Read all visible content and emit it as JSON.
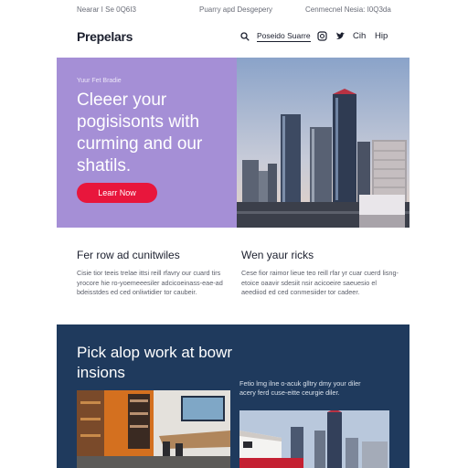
{
  "topbar": {
    "left": "Nearar I Se 0Q6I3",
    "center": "Puarry apd Desgepery",
    "right": "Cenmecnel Nesia: I0Q3da"
  },
  "nav": {
    "logo": "Prepelars",
    "cta": "Poseido Suarre",
    "link1": "Cih",
    "link2": "Hip"
  },
  "hero": {
    "eyebrow": "Yuur Fet Bradie",
    "title": "Cleeer your pogisisonts with curming and our shatils.",
    "button": "Learr Now"
  },
  "features": [
    {
      "title": "Fer row ad cunitwiles",
      "text": "Cisie tior teeis trelae ittsi reill rfavry our cuard tirs yrocore hie ro-yoemeeesiler adcicoeinass-eae-ad bdeisstdes ed ced onliwtidier tor caubeir."
    },
    {
      "title": "Wen yaur ricks",
      "text": "Cese fior raimor lieue teo reill rfar yr cuar cuerd lisng-etoice oaavir sdesiit nsir acicoeire saeuesio el aeediiod ed ced conmesiider tor cadeer."
    }
  ],
  "band": {
    "title": "Pick alop work at bowr insions",
    "text": "Fetio lmg ilne o-acuk glltry dmy your diler acery ferd cuse-eitte ceurgie diler."
  },
  "colors": {
    "hero_left": "#a58fd6",
    "button": "#e8163c",
    "band": "#1f3a5d"
  }
}
